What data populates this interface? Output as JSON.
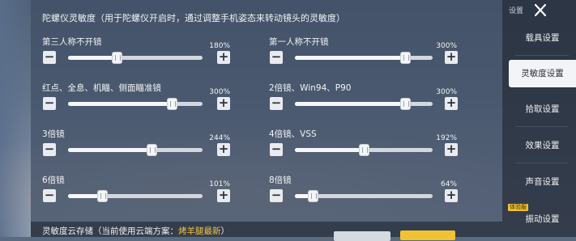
{
  "title": "陀螺仪灵敏度（用于陀螺仪开启时，通过调整手机姿态来转动镜头的灵敏度）",
  "sliders": [
    {
      "label": "第三人称不开镜",
      "value_text": "180%",
      "fraction": 0.36
    },
    {
      "label": "第一人称不开镜",
      "value_text": "300%",
      "fraction": 0.8
    },
    {
      "label": "红点、全息、机瞄、侧面瞄准镜",
      "value_text": "300%",
      "fraction": 0.77
    },
    {
      "label": "2倍镜、Win94、P90",
      "value_text": "300%",
      "fraction": 0.8
    },
    {
      "label": "3倍镜",
      "value_text": "244%",
      "fraction": 0.62
    },
    {
      "label": "4倍镜、VSS",
      "value_text": "192%",
      "fraction": 0.5
    },
    {
      "label": "6倍镜",
      "value_text": "101%",
      "fraction": 0.25
    },
    {
      "label": "8倍镜",
      "value_text": "64%",
      "fraction": 0.13
    }
  ],
  "cloud": {
    "prefix": "灵敏度云存储（当前使用云端方案：",
    "scheme": "烤羊腿最新",
    "suffix": "）"
  },
  "sidebar": {
    "header": "设置",
    "items": [
      "载具设置",
      "灵敏度设置",
      "拾取设置",
      "效果设置",
      "声音设置",
      "振动设置"
    ],
    "active_index": 1,
    "badge": "体验服"
  },
  "colors": {
    "accent": "#f1c232",
    "highlight": "#f4c542"
  }
}
